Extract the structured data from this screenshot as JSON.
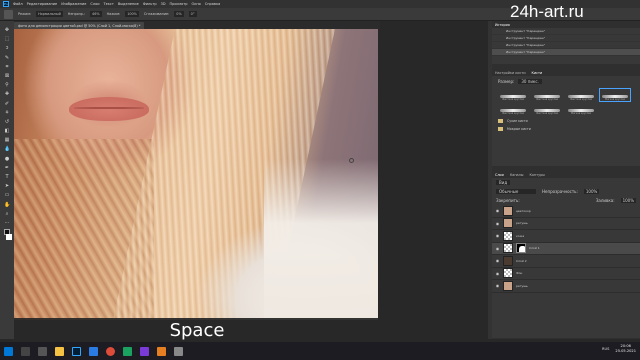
{
  "app": {
    "logo": "Ps"
  },
  "menu": [
    "Файл",
    "Редактирование",
    "Изображение",
    "Слои",
    "Текст",
    "Выделение",
    "Фильтр",
    "3D",
    "Просмотр",
    "Окно",
    "Справка"
  ],
  "options": {
    "mode_label": "Режим:",
    "mode_value": "Нормальный",
    "opacity_label": "Непрозр.:",
    "opacity_value": "46%",
    "flow_label": "Нажим:",
    "flow_value": "100%",
    "smooth_label": "Сглаживание:",
    "smooth_value": "0%",
    "angle_value": "0°"
  },
  "document": {
    "tab_title": "фото для демонстрации цветой.psd @ 50% (Слой 1, Слой-маска/8) *"
  },
  "watermark": "24h-art.ru",
  "subtitle": "Space",
  "history": {
    "tab": "История",
    "items": [
      "Инструмент \"Карандаш\"",
      "Инструмент \"Карандаш\"",
      "Инструмент \"Карандаш\"",
      "Инструмент \"Карандаш\""
    ]
  },
  "brushes": {
    "tabs": [
      "Настройки кисти",
      "Кисти"
    ],
    "size_label": "Размер:",
    "size_value": "30 пикс.",
    "presets": [
      "Жесткая круглая",
      "Жесткая круглая",
      "Жесткая круглая",
      "Мягкая круглая",
      "Жесткая круглая",
      "Жесткая круглая",
      "Мягкая круглая"
    ],
    "folders": [
      "Сухие кисти",
      "Мокрые кисти"
    ]
  },
  "layers": {
    "tabs": [
      "Слои",
      "Каналы",
      "Контуры"
    ],
    "kind_label": "Вид",
    "blend_mode": "Обычные",
    "opacity_label": "Непрозрачность:",
    "opacity_value": "100%",
    "lock_label": "Закрепить:",
    "fill_label": "Заливка:",
    "fill_value": "100%",
    "items": [
      {
        "name": "цветокор",
        "thumb": "photo"
      },
      {
        "name": "ретушь",
        "thumb": "photo"
      },
      {
        "name": "кожа",
        "thumb": "checker"
      },
      {
        "name": "Слой 1",
        "thumb": "checker",
        "mask": true
      },
      {
        "name": "Слой 2",
        "thumb": "dark"
      },
      {
        "name": "Фон",
        "thumb": "checker"
      },
      {
        "name": "ретушь",
        "thumb": "photo"
      }
    ]
  },
  "taskbar": {
    "lang": "RUS",
    "time": "20:06",
    "date": "25.05.2021"
  },
  "colors": {
    "accent": "#31a8ff",
    "panel": "#383838",
    "canvas_bg": "#282828"
  }
}
